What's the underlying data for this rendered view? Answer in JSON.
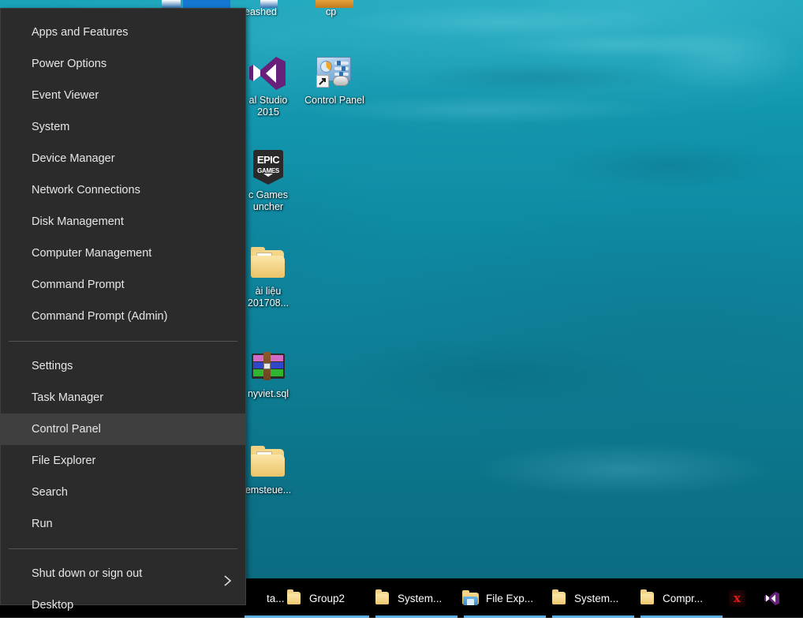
{
  "window": {
    "os": "Windows 10",
    "menu_name": "Win+X Power User Menu"
  },
  "winx_menu": {
    "groups": [
      {
        "items": [
          {
            "label": "Apps and Features",
            "name": "apps-and-features",
            "selected": false,
            "submenu": false
          },
          {
            "label": "Power Options",
            "name": "power-options",
            "selected": false,
            "submenu": false
          },
          {
            "label": "Event Viewer",
            "name": "event-viewer",
            "selected": false,
            "submenu": false
          },
          {
            "label": "System",
            "name": "system",
            "selected": false,
            "submenu": false
          },
          {
            "label": "Device Manager",
            "name": "device-manager",
            "selected": false,
            "submenu": false
          },
          {
            "label": "Network Connections",
            "name": "network-connections",
            "selected": false,
            "submenu": false
          },
          {
            "label": "Disk Management",
            "name": "disk-management",
            "selected": false,
            "submenu": false
          },
          {
            "label": "Computer Management",
            "name": "computer-management",
            "selected": false,
            "submenu": false
          },
          {
            "label": "Command Prompt",
            "name": "command-prompt",
            "selected": false,
            "submenu": false
          },
          {
            "label": "Command Prompt (Admin)",
            "name": "command-prompt-admin",
            "selected": false,
            "submenu": false
          }
        ]
      },
      {
        "items": [
          {
            "label": "Settings",
            "name": "settings",
            "selected": false,
            "submenu": false
          },
          {
            "label": "Task Manager",
            "name": "task-manager",
            "selected": false,
            "submenu": false
          },
          {
            "label": "Control Panel",
            "name": "control-panel",
            "selected": true,
            "submenu": false
          },
          {
            "label": "File Explorer",
            "name": "file-explorer",
            "selected": false,
            "submenu": false
          },
          {
            "label": "Search",
            "name": "search",
            "selected": false,
            "submenu": false
          },
          {
            "label": "Run",
            "name": "run",
            "selected": false,
            "submenu": false
          }
        ]
      },
      {
        "items": [
          {
            "label": "Shut down or sign out",
            "name": "shut-down-or-sign-out",
            "selected": false,
            "submenu": true
          },
          {
            "label": "Desktop",
            "name": "desktop",
            "selected": false,
            "submenu": false
          }
        ]
      }
    ],
    "selected_item": "Control Panel",
    "highlight_color": "#3f3f3f",
    "background_color": "#2b2b2b",
    "text_color": "#e6e6e6"
  },
  "desktop": {
    "background_color": "#0e87a0",
    "clipped_top_labels": [
      {
        "text": "eashed",
        "name": "clipped-label-unleashed"
      },
      {
        "text": "cp",
        "name": "clipped-label-cp"
      }
    ],
    "icons": [
      {
        "name": "visual-studio-2015",
        "icon": "visual-studio-icon",
        "label_lines": [
          "al Studio",
          "2015"
        ],
        "clipped": true
      },
      {
        "name": "control-panel-shortcut",
        "icon": "control-panel-icon",
        "label_lines": [
          "Control Panel"
        ],
        "shortcut": true,
        "clipped": false
      },
      {
        "name": "epic-games-launcher",
        "icon": "epic-games-icon",
        "label_lines": [
          "c Games",
          "uncher"
        ],
        "clipped": true
      },
      {
        "name": "tai-lieu-folder",
        "icon": "folder-icon",
        "label_lines": [
          "ài liệu",
          "201708..."
        ],
        "clipped": true
      },
      {
        "name": "quyviet-sql-file",
        "icon": "winrar-icon",
        "label_lines": [
          "nyviet.sql"
        ],
        "clipped": true
      },
      {
        "name": "systemsteuerung-folder",
        "icon": "folder-icon",
        "label_lines": [
          "emsteue..."
        ],
        "clipped": true
      }
    ]
  },
  "taskbar": {
    "background_color": "#000000",
    "active_indicator_color": "#5daee0",
    "items": [
      {
        "label": "ta...",
        "icon": "folder-icon",
        "name": "taskbar-item-ta",
        "active": true,
        "clipped": true
      },
      {
        "label": "Group2",
        "icon": "folder-icon",
        "name": "taskbar-item-group2",
        "active": true,
        "clipped": false
      },
      {
        "label": "System...",
        "icon": "folder-icon",
        "name": "taskbar-item-system-1",
        "active": true,
        "clipped": false
      },
      {
        "label": "File Exp...",
        "icon": "file-explorer-icon",
        "name": "taskbar-item-file-explorer",
        "active": true,
        "clipped": false
      },
      {
        "label": "System...",
        "icon": "folder-icon",
        "name": "taskbar-item-system-2",
        "active": true,
        "clipped": false
      },
      {
        "label": "Compr...",
        "icon": "folder-icon",
        "name": "taskbar-item-compr",
        "active": true,
        "clipped": false
      },
      {
        "label": "",
        "icon": "garena-icon",
        "name": "taskbar-item-garena",
        "active": false,
        "clipped": false
      },
      {
        "label": "",
        "icon": "visual-studio-icon",
        "name": "taskbar-item-visual-studio",
        "active": false,
        "clipped": false
      }
    ]
  }
}
